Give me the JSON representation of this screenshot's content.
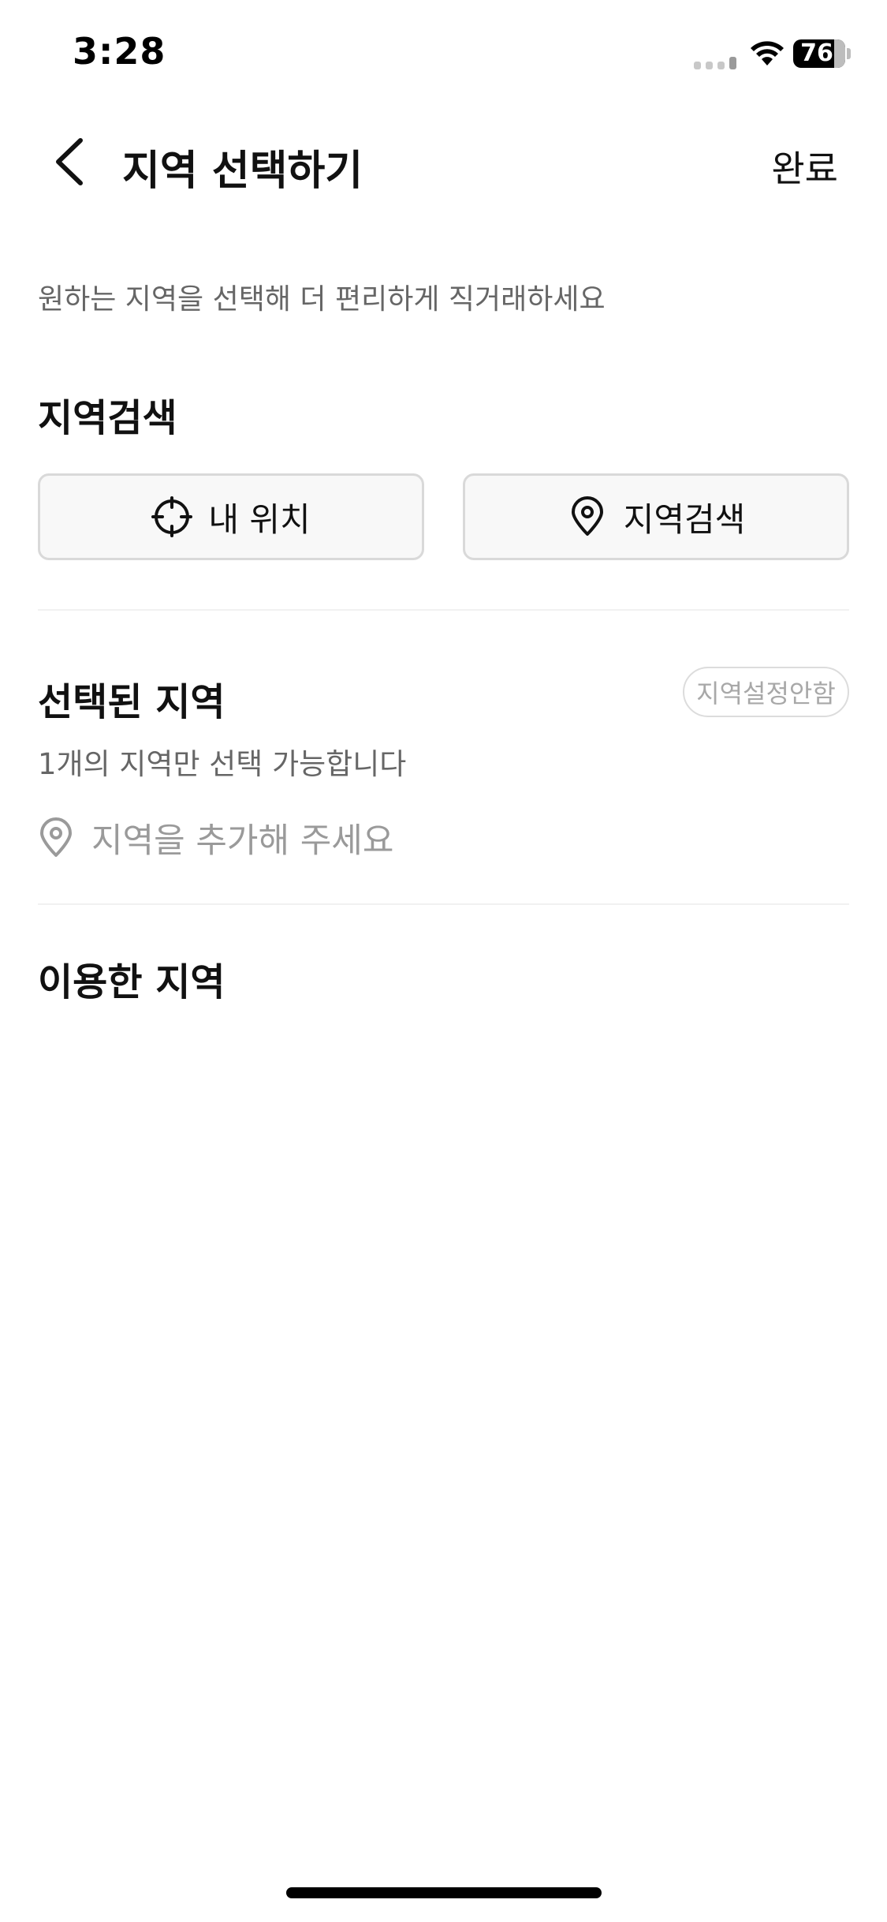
{
  "status_bar": {
    "time": "3:28",
    "battery_level": "76",
    "icons": [
      "cellular-signal-icon",
      "wifi-icon",
      "battery-icon"
    ]
  },
  "header": {
    "back_icon": "chevron-left-icon",
    "title": "지역 선택하기",
    "done_label": "완료"
  },
  "description": "원하는 지역을 선택해 더 편리하게 직거래하세요",
  "search_section": {
    "title": "지역검색",
    "my_location_label": "내 위치",
    "my_location_icon": "crosshair-icon",
    "search_label": "지역검색",
    "search_icon": "map-pin-icon"
  },
  "selected_section": {
    "title": "선택된 지역",
    "no_region_label": "지역설정안함",
    "limit_text": "1개의 지역만 선택 가능합니다",
    "add_placeholder": "지역을 추가해 주세요",
    "add_icon": "map-pin-icon"
  },
  "used_section": {
    "title": "이용한 지역"
  },
  "colors": {
    "text_primary": "#111111",
    "text_secondary": "#666666",
    "text_placeholder": "#9a9a9a",
    "button_border": "#d9d9d9",
    "button_bg": "#f8f8f8",
    "background": "#ffffff"
  }
}
